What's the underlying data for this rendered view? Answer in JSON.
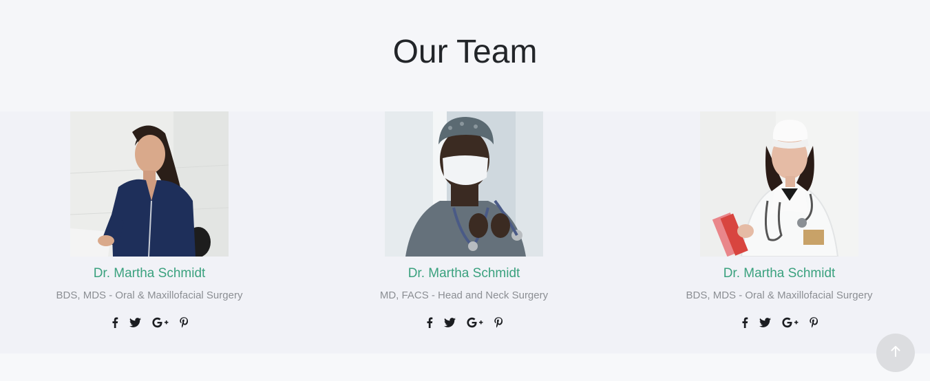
{
  "section": {
    "title": "Our Team"
  },
  "team": [
    {
      "name": "Dr. Martha Schmidt",
      "role": "BDS, MDS - Oral & Maxillofacial Surgery",
      "photo": "doctor-portrait-smiling-woman-navy-scrubs"
    },
    {
      "name": "Dr. Martha Schmidt",
      "role": "MD, FACS - Head and Neck Surgery",
      "photo": "doctor-portrait-man-surgical-mask"
    },
    {
      "name": "Dr. Martha Schmidt",
      "role": "BDS, MDS - Oral & Maxillofacial Surgery",
      "photo": "doctor-portrait-woman-white-coat"
    }
  ],
  "socials": [
    "facebook-icon",
    "twitter-icon",
    "google-plus-icon",
    "pinterest-icon"
  ],
  "colors": {
    "accent": "#3aa17e",
    "title": "#222529",
    "muted": "#8b8e93",
    "background": "#f5f6f9",
    "band": "#f1f2f7",
    "scroll_button": "#dcdde0"
  },
  "scroll_top": {
    "icon": "arrow-up-icon"
  }
}
